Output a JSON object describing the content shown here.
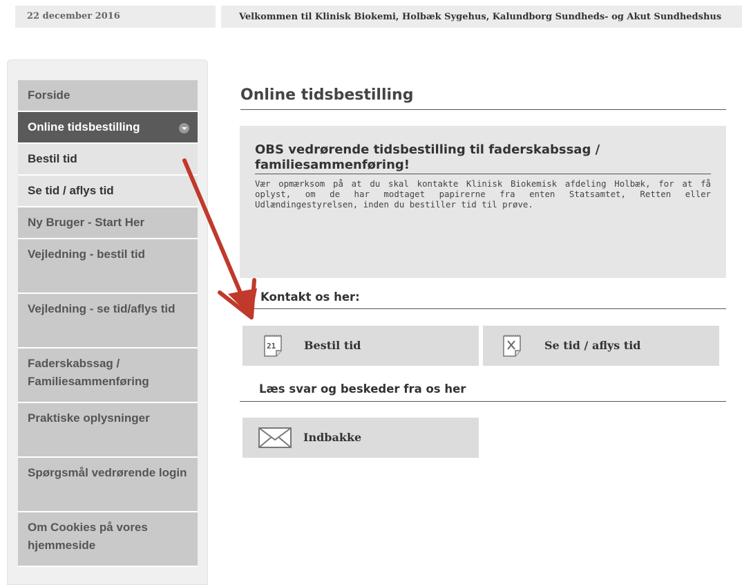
{
  "header": {
    "date": "22 december 2016",
    "welcome": "Velkommen til Klinisk Biokemi, Holbæk Sygehus, Kalundborg Sundheds- og Akut Sundhedshus"
  },
  "sidebar": {
    "items": [
      {
        "label": "Forside"
      },
      {
        "label": "Online tidsbestilling"
      },
      {
        "label": "Bestil tid"
      },
      {
        "label": "Se tid / aflys tid"
      },
      {
        "label": "Ny Bruger - Start Her"
      },
      {
        "label": "Vejledning - bestil tid"
      },
      {
        "label": "Vejledning - se tid/aflys tid"
      },
      {
        "label": "Faderskabssag / Familiesammenføring"
      },
      {
        "label": "Praktiske oplysninger"
      },
      {
        "label": "Spørgsmål vedrørende login"
      },
      {
        "label": "Om Cookies på vores hjemmeside"
      }
    ]
  },
  "main": {
    "title": "Online tidsbestilling",
    "notice": {
      "title": "OBS vedrørende tidsbestilling til faderskabssag / familiesammenføring!",
      "body": "Vær opmærksom på at du skal kontakte Klinisk Biokemisk afdeling Holbæk, for at få oplyst, om de har modtaget papirerne fra enten Statsamtet, Retten eller Udlændingestyrelsen, inden du bestiller tid til prøve."
    },
    "contact_heading": "Kontakt os her:",
    "book_button": "Bestil tid",
    "calendar_icon_number": "21",
    "cancel_button": "Se tid / aflys tid",
    "read_heading": "Læs svar og beskeder fra os her",
    "inbox_button": "Indbakke"
  },
  "icons": {
    "calendar": "calendar-icon",
    "cancel": "calendar-x-icon",
    "inbox": "envelope-icon",
    "dropdown": "chevron-down-icon",
    "annotation": "arrow-annotation"
  },
  "colors": {
    "active_nav": "#5a5a5a",
    "nav": "#c9c9c9",
    "nav_light": "#e4e4e4",
    "arrow": "#c0392b"
  }
}
